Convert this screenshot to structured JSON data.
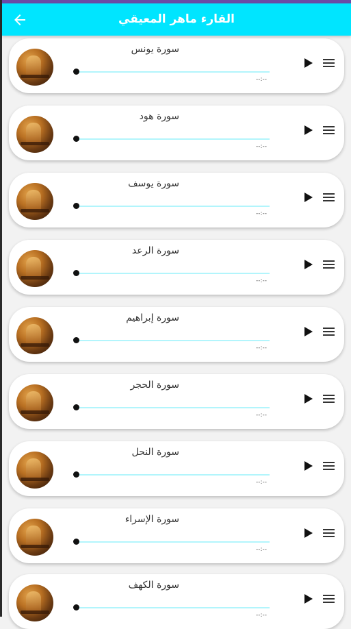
{
  "appbar": {
    "title": "القارء ماهر المعيقي",
    "back_icon": "arrow-left-icon",
    "color": "#00e5ff"
  },
  "track_color": "#b2f5fc",
  "items": [
    {
      "title": "سورة يونس",
      "time": "--:--",
      "progress": 0
    },
    {
      "title": "سورة هود",
      "time": "--:--",
      "progress": 0
    },
    {
      "title": "سورة يوسف",
      "time": "--:--",
      "progress": 0
    },
    {
      "title": "سورة الرعد",
      "time": "--:--",
      "progress": 0
    },
    {
      "title": "سورة إبراهيم",
      "time": "--:--",
      "progress": 0
    },
    {
      "title": "سورة الحجر",
      "time": "--:--",
      "progress": 0
    },
    {
      "title": "سورة النحل",
      "time": "--:--",
      "progress": 0
    },
    {
      "title": "سورة الإسراء",
      "time": "--:--",
      "progress": 0
    },
    {
      "title": "سورة الكهف",
      "time": "--:--",
      "progress": 0
    }
  ]
}
